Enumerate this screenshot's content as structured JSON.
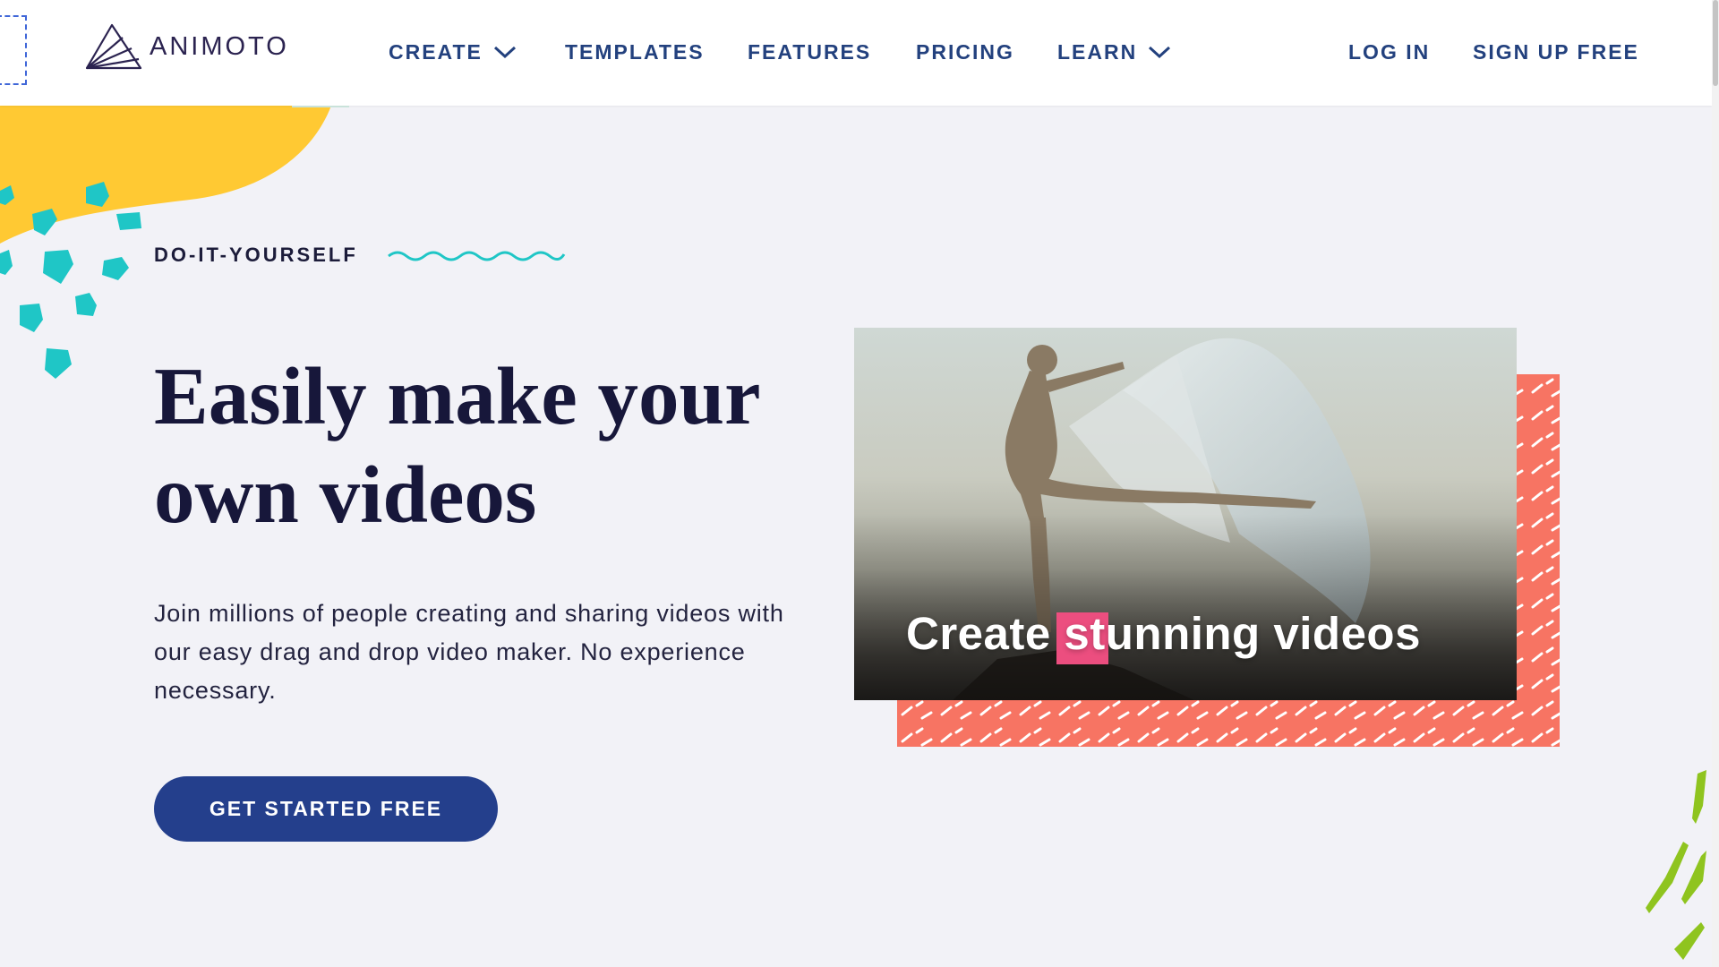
{
  "brand": {
    "logo_text": "ANIMOTO",
    "logo_icon": "paper-plane-fan-icon"
  },
  "nav": {
    "items": [
      {
        "label": "CREATE",
        "has_dropdown": true
      },
      {
        "label": "TEMPLATES",
        "has_dropdown": false
      },
      {
        "label": "FEATURES",
        "has_dropdown": false
      },
      {
        "label": "PRICING",
        "has_dropdown": false
      },
      {
        "label": "LEARN",
        "has_dropdown": true
      }
    ],
    "login_label": "LOG IN",
    "signup_label": "SIGN UP FREE"
  },
  "hero": {
    "eyebrow": "DO-IT-YOURSELF",
    "headline": "Easily make your own videos",
    "description": "Join millions of people creating and sharing videos with our easy drag and drop video maker. No experience necessary.",
    "cta_label": "GET STARTED FREE"
  },
  "media": {
    "caption_before": "Create ",
    "caption_highlight": "st",
    "caption_after": "unning videos",
    "highlight_color": "#ec4e7f",
    "backdrop_color": "#f77463"
  },
  "colors": {
    "nav_text": "#23417e",
    "headline": "#17173a",
    "cta_bg": "#243f8c",
    "yellow_blob": "#ffc933",
    "teal_accent": "#1fc6c6",
    "pink_dots": "#ec4e7f",
    "lime_strokes": "#8fc41f"
  }
}
